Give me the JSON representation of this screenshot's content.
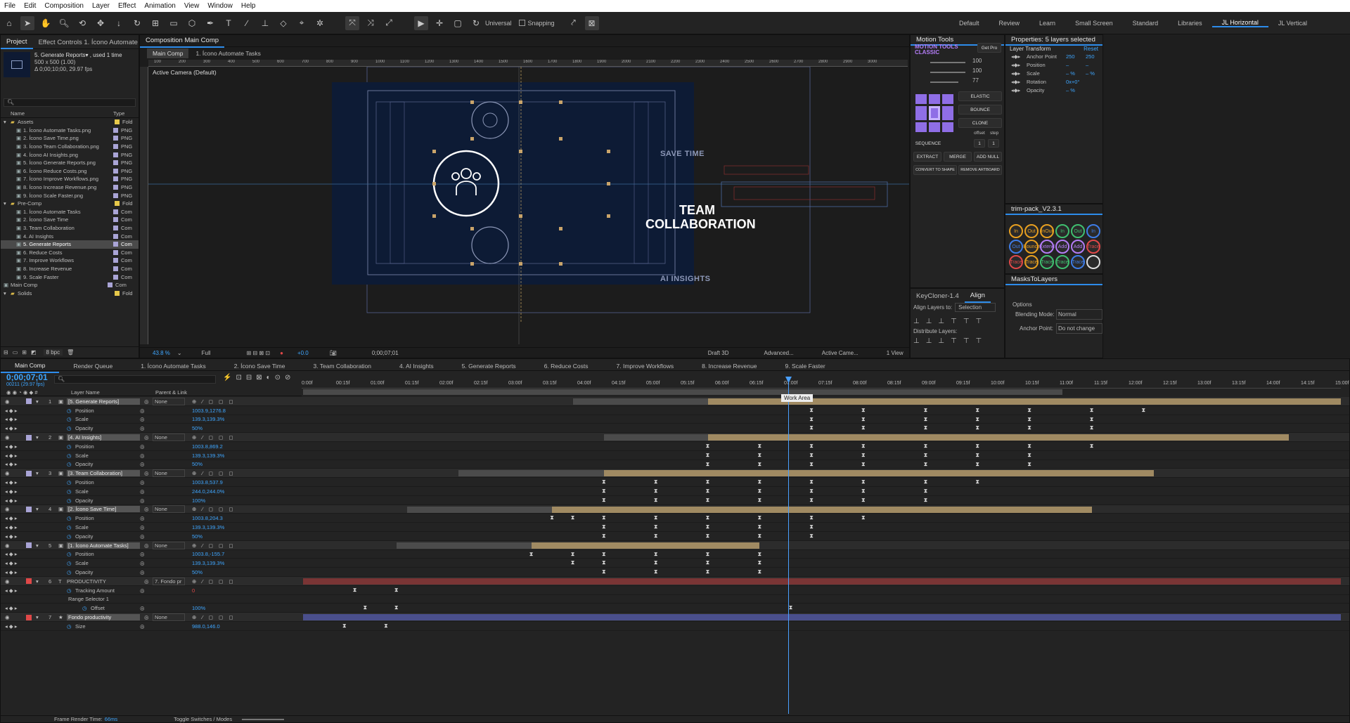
{
  "menu": [
    "File",
    "Edit",
    "Composition",
    "Layer",
    "Effect",
    "Animation",
    "View",
    "Window",
    "Help"
  ],
  "toolbar": {
    "axis_mode": "Universal",
    "snapping": "Snapping"
  },
  "workspaces": [
    "Default",
    "Review",
    "Learn",
    "Small Screen",
    "Standard",
    "Libraries",
    "JL Horizontal",
    "JL Vertical"
  ],
  "active_workspace": "JL Horizontal",
  "project": {
    "tab": "Project",
    "effect_tab": "Effect Controls 1. Ícono Automate Ta",
    "item_name": "5. Generate Reports▾ , used 1 time",
    "item_size": "500 x 500 (1.00)",
    "item_dur": "Δ 0;00;10;00, 29.97 fps",
    "col_name": "Name",
    "col_type": "Type",
    "items": [
      {
        "n": "Assets",
        "t": "Fold",
        "lvl": 0,
        "kind": "folder",
        "c": "#e6c84a"
      },
      {
        "n": "1. Ícono Automate Tasks.png",
        "t": "PNG",
        "lvl": 1,
        "kind": "file",
        "c": "#a9a4d6"
      },
      {
        "n": "2. Ícono Save Time.png",
        "t": "PNG",
        "lvl": 1,
        "kind": "file",
        "c": "#a9a4d6"
      },
      {
        "n": "3. Ícono Team Collaboration.png",
        "t": "PNG",
        "lvl": 1,
        "kind": "file",
        "c": "#a9a4d6"
      },
      {
        "n": "4. Ícono AI Insights.png",
        "t": "PNG",
        "lvl": 1,
        "kind": "file",
        "c": "#a9a4d6"
      },
      {
        "n": "5. Ícono Generate Reports.png",
        "t": "PNG",
        "lvl": 1,
        "kind": "file",
        "c": "#a9a4d6"
      },
      {
        "n": "6. Ícono Reduce Costs.png",
        "t": "PNG",
        "lvl": 1,
        "kind": "file",
        "c": "#a9a4d6"
      },
      {
        "n": "7. Ícono Improve Workflows.png",
        "t": "PNG",
        "lvl": 1,
        "kind": "file",
        "c": "#a9a4d6"
      },
      {
        "n": "8. Ícono Increase Revenue.png",
        "t": "PNG",
        "lvl": 1,
        "kind": "file",
        "c": "#a9a4d6"
      },
      {
        "n": "9. Ícono Scale Faster.png",
        "t": "PNG",
        "lvl": 1,
        "kind": "file",
        "c": "#a9a4d6"
      },
      {
        "n": "Pre-Comp",
        "t": "Fold",
        "lvl": 0,
        "kind": "folder",
        "c": "#e6c84a"
      },
      {
        "n": "1. Ícono Automate Tasks",
        "t": "Com",
        "lvl": 1,
        "kind": "comp",
        "c": "#a9a4d6"
      },
      {
        "n": "2. Ícono Save Time",
        "t": "Com",
        "lvl": 1,
        "kind": "comp",
        "c": "#a9a4d6"
      },
      {
        "n": "3. Team Collaboration",
        "t": "Com",
        "lvl": 1,
        "kind": "comp",
        "c": "#a9a4d6"
      },
      {
        "n": "4. AI Insights",
        "t": "Com",
        "lvl": 1,
        "kind": "comp",
        "c": "#a9a4d6"
      },
      {
        "n": "5. Generate Reports",
        "t": "Com",
        "lvl": 1,
        "kind": "comp",
        "c": "#a9a4d6",
        "sel": true
      },
      {
        "n": "6. Reduce Costs",
        "t": "Com",
        "lvl": 1,
        "kind": "comp",
        "c": "#a9a4d6"
      },
      {
        "n": "7. Improve Workflows",
        "t": "Com",
        "lvl": 1,
        "kind": "comp",
        "c": "#a9a4d6"
      },
      {
        "n": "8. Increase Revenue",
        "t": "Com",
        "lvl": 1,
        "kind": "comp",
        "c": "#a9a4d6"
      },
      {
        "n": "9. Scale Faster",
        "t": "Com",
        "lvl": 1,
        "kind": "comp",
        "c": "#a9a4d6"
      },
      {
        "n": "Main Comp",
        "t": "Com",
        "lvl": 0,
        "kind": "comp",
        "c": "#a9a4d6"
      },
      {
        "n": "Solids",
        "t": "Fold",
        "lvl": 0,
        "kind": "folder",
        "c": "#e6c84a"
      }
    ],
    "bpc": "8 bpc"
  },
  "comp": {
    "tab": "Composition Main Comp",
    "subtabs": [
      "Main Comp",
      "1. Ícono Automate Tasks"
    ],
    "camera": "Active Camera (Default)",
    "ruler": [
      "100",
      "200",
      "300",
      "400",
      "500",
      "600",
      "700",
      "800",
      "900",
      "1000",
      "1100",
      "1200",
      "1300",
      "1400",
      "1500",
      "1600",
      "1700",
      "1800",
      "1900",
      "2000",
      "2100",
      "2200",
      "2300",
      "2400",
      "2500",
      "2600",
      "2700",
      "2800",
      "2900",
      "3000"
    ],
    "canvas": {
      "save_time": "SAVE TIME",
      "team1": "TEAM",
      "team2": "COLLABORATION",
      "ai": "AI INSIGHTS"
    },
    "footer": {
      "zoom": "43.8 %",
      "res": "Full",
      "exposure": "+0.0",
      "time": "0;00;07;01",
      "renderer": "Draft 3D",
      "advanced": "Advanced...",
      "camera": "Active Came...",
      "view": "1 View"
    }
  },
  "motion_tools": {
    "tab": "Motion Tools",
    "brand1": "MOTION TOOLS",
    "brand2": "CLASSIC",
    "getpro": "Get Pro",
    "sliders": [
      "100",
      "100",
      "77"
    ],
    "buttons": {
      "elastic": "ELASTIC",
      "bounce": "BOUNCE",
      "clone": "CLONE",
      "offset": "offset",
      "step": "step",
      "sequence": "SEQUENCE",
      "seq1": "1",
      "seq2": "1",
      "extract": "EXTRACT",
      "merge": "MERGE",
      "addnull": "ADD NULL",
      "convert": "CONVERT TO SHAPE",
      "remove": "REMOVE ARTBOARD"
    }
  },
  "properties": {
    "tab": "Properties: 5 layers selected",
    "section": "Layer Transform",
    "reset": "Reset",
    "rows": [
      {
        "label": "Anchor Point",
        "v1": "250",
        "v2": "250"
      },
      {
        "label": "Position",
        "v1": "–",
        "v2": "–"
      },
      {
        "label": "Scale",
        "v1": "– %",
        "v2": "– %"
      },
      {
        "label": "Rotation",
        "v1": "0x+0°",
        "v2": ""
      },
      {
        "label": "Opacity",
        "v1": "– %",
        "v2": ""
      }
    ]
  },
  "trim": {
    "tab": "trim-pack_V2.3.1",
    "buttons": [
      "In",
      "Out",
      "InOut",
      "In",
      "Out",
      "In",
      "Out",
      "Bounce",
      "Extend",
      "Add",
      "Add",
      "Trace",
      "Trace",
      "Trace",
      "Trace",
      "Trace",
      "Trace",
      ""
    ]
  },
  "masks": {
    "tab": "MasksToLayers",
    "options": "Options",
    "blend_label": "Blending Mode:",
    "blend_val": "Normal",
    "anchor_label": "Anchor Point:",
    "anchor_val": "Do not change"
  },
  "align": {
    "tabs": [
      "KeyCloner-1.4",
      "Align"
    ],
    "align_to": "Align Layers to:",
    "selection": "Selection",
    "distribute": "Distribute Layers:"
  },
  "timeline": {
    "tabs": [
      "Main Comp",
      "Render Queue",
      "1. Ícono Automate Tasks",
      "2. Ícono Save Time",
      "3. Team Collaboration",
      "4. AI Insights",
      "5. Generate Reports",
      "6. Reduce Costs",
      "7. Improve Workflows",
      "8. Increase Revenue",
      "9. Scale Faster"
    ],
    "timecode": "0;00;07;01",
    "fps": "00211 (29.97 fps)",
    "search": "",
    "col_layer": "Layer Name",
    "col_parent": "Parent & Link",
    "ruler": [
      "0:00f",
      "00:15f",
      "01:00f",
      "01:15f",
      "02:00f",
      "02:15f",
      "03:00f",
      "03:15f",
      "04:00f",
      "04:15f",
      "05:00f",
      "05:15f",
      "06:00f",
      "06:15f",
      "07:00f",
      "07:15f",
      "08:00f",
      "08:15f",
      "09:00f",
      "09:15f",
      "10:00f",
      "10:15f",
      "11:00f",
      "11:15f",
      "12:00f",
      "12:15f",
      "13:00f",
      "13:15f",
      "14:00f",
      "14:15f",
      "15:00f"
    ],
    "work_area_tip": "Work Area",
    "footer": {
      "render_label": "Frame Render Time:",
      "render_val": "66ms",
      "toggle": "Toggle Switches / Modes"
    },
    "rows": [
      {
        "type": "layer",
        "num": "1",
        "name": "[5. Generate Reports]",
        "parent": "None",
        "c": "#a9a4d6",
        "bar": [
          0.39,
          1.0
        ],
        "bar_c": "#a08a62",
        "pre": [
          0.26,
          0.39
        ]
      },
      {
        "type": "prop",
        "name": "Position",
        "val": "1003.9,1276.8",
        "kf": [
          0.49,
          0.54,
          0.6,
          0.65,
          0.7,
          0.76,
          0.81
        ]
      },
      {
        "type": "prop",
        "name": "Scale",
        "val": "139.3,139.3%",
        "link": true,
        "kf": [
          0.49,
          0.54,
          0.6,
          0.65,
          0.7,
          0.76
        ]
      },
      {
        "type": "prop",
        "name": "Opacity",
        "val": "50%",
        "kf": [
          0.49,
          0.54,
          0.6,
          0.65,
          0.7,
          0.76
        ]
      },
      {
        "type": "layer",
        "num": "2",
        "name": "[4. AI Insights]",
        "parent": "None",
        "c": "#a9a4d6",
        "bar": [
          0.39,
          0.95
        ],
        "bar_c": "#a08a62",
        "pre": [
          0.29,
          0.39
        ]
      },
      {
        "type": "prop",
        "name": "Position",
        "val": "1003.8,869.2",
        "kf": [
          0.39,
          0.44,
          0.49,
          0.54,
          0.6,
          0.65,
          0.7,
          0.76
        ]
      },
      {
        "type": "prop",
        "name": "Scale",
        "val": "139.3,139.3%",
        "link": true,
        "kf": [
          0.39,
          0.44,
          0.49,
          0.54,
          0.6,
          0.65,
          0.7
        ]
      },
      {
        "type": "prop",
        "name": "Opacity",
        "val": "50%",
        "kf": [
          0.39,
          0.44,
          0.49,
          0.54,
          0.6,
          0.65,
          0.7
        ]
      },
      {
        "type": "layer",
        "num": "3",
        "name": "[3. Team Collaboration]",
        "parent": "None",
        "c": "#a9a4d6",
        "bar": [
          0.29,
          0.82
        ],
        "bar_c": "#a08a62",
        "pre": [
          0.15,
          0.29
        ]
      },
      {
        "type": "prop",
        "name": "Position",
        "val": "1003.8,537.9",
        "kf": [
          0.29,
          0.34,
          0.39,
          0.44,
          0.49,
          0.54,
          0.6,
          0.65
        ]
      },
      {
        "type": "prop",
        "name": "Scale",
        "val": "244.0,244.0%",
        "link": true,
        "kf": [
          0.29,
          0.34,
          0.39,
          0.44,
          0.49,
          0.54,
          0.6
        ]
      },
      {
        "type": "prop",
        "name": "Opacity",
        "val": "100%",
        "kf": [
          0.29,
          0.34,
          0.39,
          0.44,
          0.49,
          0.54,
          0.6
        ]
      },
      {
        "type": "layer",
        "num": "4",
        "name": "[2. Ícono Save Time]",
        "parent": "None",
        "c": "#a9a4d6",
        "bar": [
          0.24,
          0.76
        ],
        "bar_c": "#a08a62",
        "pre": [
          0.1,
          0.24
        ]
      },
      {
        "type": "prop",
        "name": "Position",
        "val": "1003.8,204.3",
        "kf": [
          0.24,
          0.26,
          0.29,
          0.34,
          0.39,
          0.44,
          0.49,
          0.54
        ]
      },
      {
        "type": "prop",
        "name": "Scale",
        "val": "139.3,139.3%",
        "link": true,
        "kf": [
          0.29,
          0.34,
          0.39,
          0.44,
          0.49
        ]
      },
      {
        "type": "prop",
        "name": "Opacity",
        "val": "50%",
        "kf": [
          0.29,
          0.34,
          0.39,
          0.44,
          0.49
        ]
      },
      {
        "type": "layer",
        "num": "5",
        "name": "[1. Ícono Automate Tasks]",
        "parent": "None",
        "c": "#a9a4d6",
        "bar": [
          0.22,
          0.44
        ],
        "bar_c": "#a08a62",
        "pre": [
          0.09,
          0.22
        ]
      },
      {
        "type": "prop",
        "name": "Position",
        "val": "1003.8,-155.7",
        "kf": [
          0.22,
          0.26,
          0.29,
          0.34,
          0.39,
          0.44
        ]
      },
      {
        "type": "prop",
        "name": "Scale",
        "val": "139.3,139.3%",
        "link": true,
        "kf": [
          0.26,
          0.29,
          0.34,
          0.39,
          0.44
        ]
      },
      {
        "type": "prop",
        "name": "Opacity",
        "val": "50%",
        "kf": [
          0.29,
          0.34,
          0.39,
          0.44
        ]
      },
      {
        "type": "layer",
        "num": "6",
        "name": "PRODUCTIVITY",
        "parent": "7. Fondo pr",
        "c": "#e04848",
        "bar": [
          0.0,
          1.0
        ],
        "bar_c": "#7a3535",
        "text": true
      },
      {
        "type": "prop",
        "name": "Tracking Amount",
        "val": "0",
        "red": true,
        "kf": [
          0.05,
          0.09
        ]
      },
      {
        "type": "group",
        "name": "Range Selector 1"
      },
      {
        "type": "prop",
        "name": "Offset",
        "val": "100%",
        "deep": true,
        "kf": [
          0.06,
          0.09,
          0.47
        ]
      },
      {
        "type": "layer",
        "num": "7",
        "name": "Fondo productivity",
        "parent": "None",
        "c": "#e04848",
        "bar": [
          0.0,
          1.0
        ],
        "bar_c": "#4a4f8c",
        "star": true
      },
      {
        "type": "prop",
        "name": "Size",
        "val": "988.0,146.0",
        "link": true,
        "kf": [
          0.04,
          0.08
        ]
      }
    ]
  }
}
